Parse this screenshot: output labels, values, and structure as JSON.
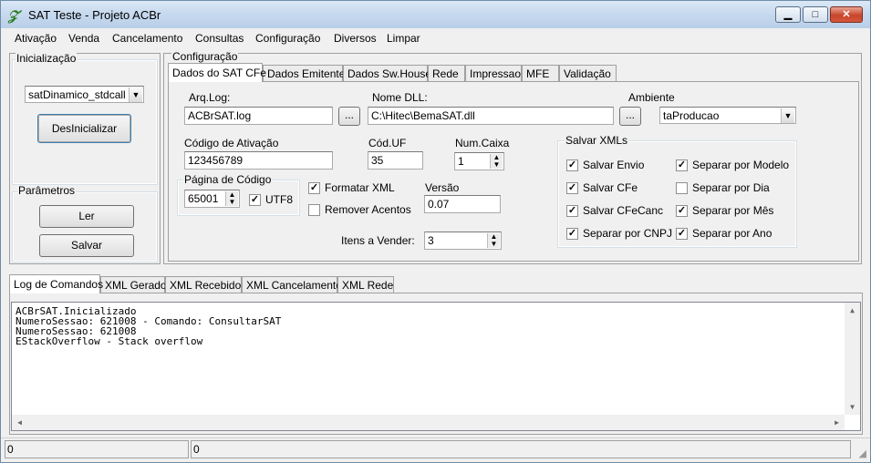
{
  "window": {
    "title": "SAT Teste - Projeto ACBr"
  },
  "menu": [
    "Ativação",
    "Venda",
    "Cancelamento",
    "Consultas",
    "Configuração",
    "Diversos",
    "Limpar"
  ],
  "inicializacao": {
    "label": "Inicialização",
    "model_value": "satDinamico_stdcall",
    "button": "DesInicializar"
  },
  "parametros": {
    "label": "Parâmetros",
    "ler": "Ler",
    "salvar": "Salvar"
  },
  "configuracao": {
    "label": "Configuração",
    "tabs": [
      "Dados do SAT CFe",
      "Dados Emitente",
      "Dados Sw.House",
      "Rede",
      "Impressao",
      "MFE",
      "Validação"
    ],
    "arq_log_label": "Arq.Log:",
    "arq_log_value": "ACBrSAT.log",
    "browse": "...",
    "nome_dll_label": "Nome DLL:",
    "nome_dll_value": "C:\\Hitec\\BemaSAT.dll",
    "ambiente_label": "Ambiente",
    "ambiente_value": "taProducao",
    "codigo_ativacao_label": "Código de Ativação",
    "codigo_ativacao_value": "123456789",
    "cod_uf_label": "Cód.UF",
    "cod_uf_value": "35",
    "num_caixa_label": "Num.Caixa",
    "num_caixa_value": "1",
    "pagina_codigo_label": "Página de Código",
    "pagina_codigo_value": "65001",
    "utf8_label": "UTF8",
    "formatar_xml_label": "Formatar XML",
    "remover_acentos_label": "Remover Acentos",
    "versao_label": "Versão",
    "versao_value": "0.07",
    "itens_vender_label": "Itens a Vender:",
    "itens_vender_value": "3",
    "salvar_xmls": {
      "label": "Salvar XMLs",
      "salvar_envio": "Salvar Envio",
      "salvar_cfe": "Salvar CFe",
      "salvar_cfecanc": "Salvar CFeCanc",
      "separar_cnpj": "Separar por CNPJ",
      "separar_modelo": "Separar por Modelo",
      "separar_dia": "Separar por Dia",
      "separar_mes": "Separar por Mês",
      "separar_ano": "Separar por Ano"
    }
  },
  "log_tabs": [
    "Log de Comandos",
    "XML Gerado",
    "XML Recebido",
    "XML Cancelamento",
    "XML Rede"
  ],
  "log_lines": [
    "ACBrSAT.Inicializado",
    "NumeroSessao: 621008 - Comando: ConsultarSAT",
    "NumeroSessao: 621008",
    "EStackOverflow - Stack overflow"
  ],
  "status": {
    "panel1": "0",
    "panel2": "0"
  }
}
